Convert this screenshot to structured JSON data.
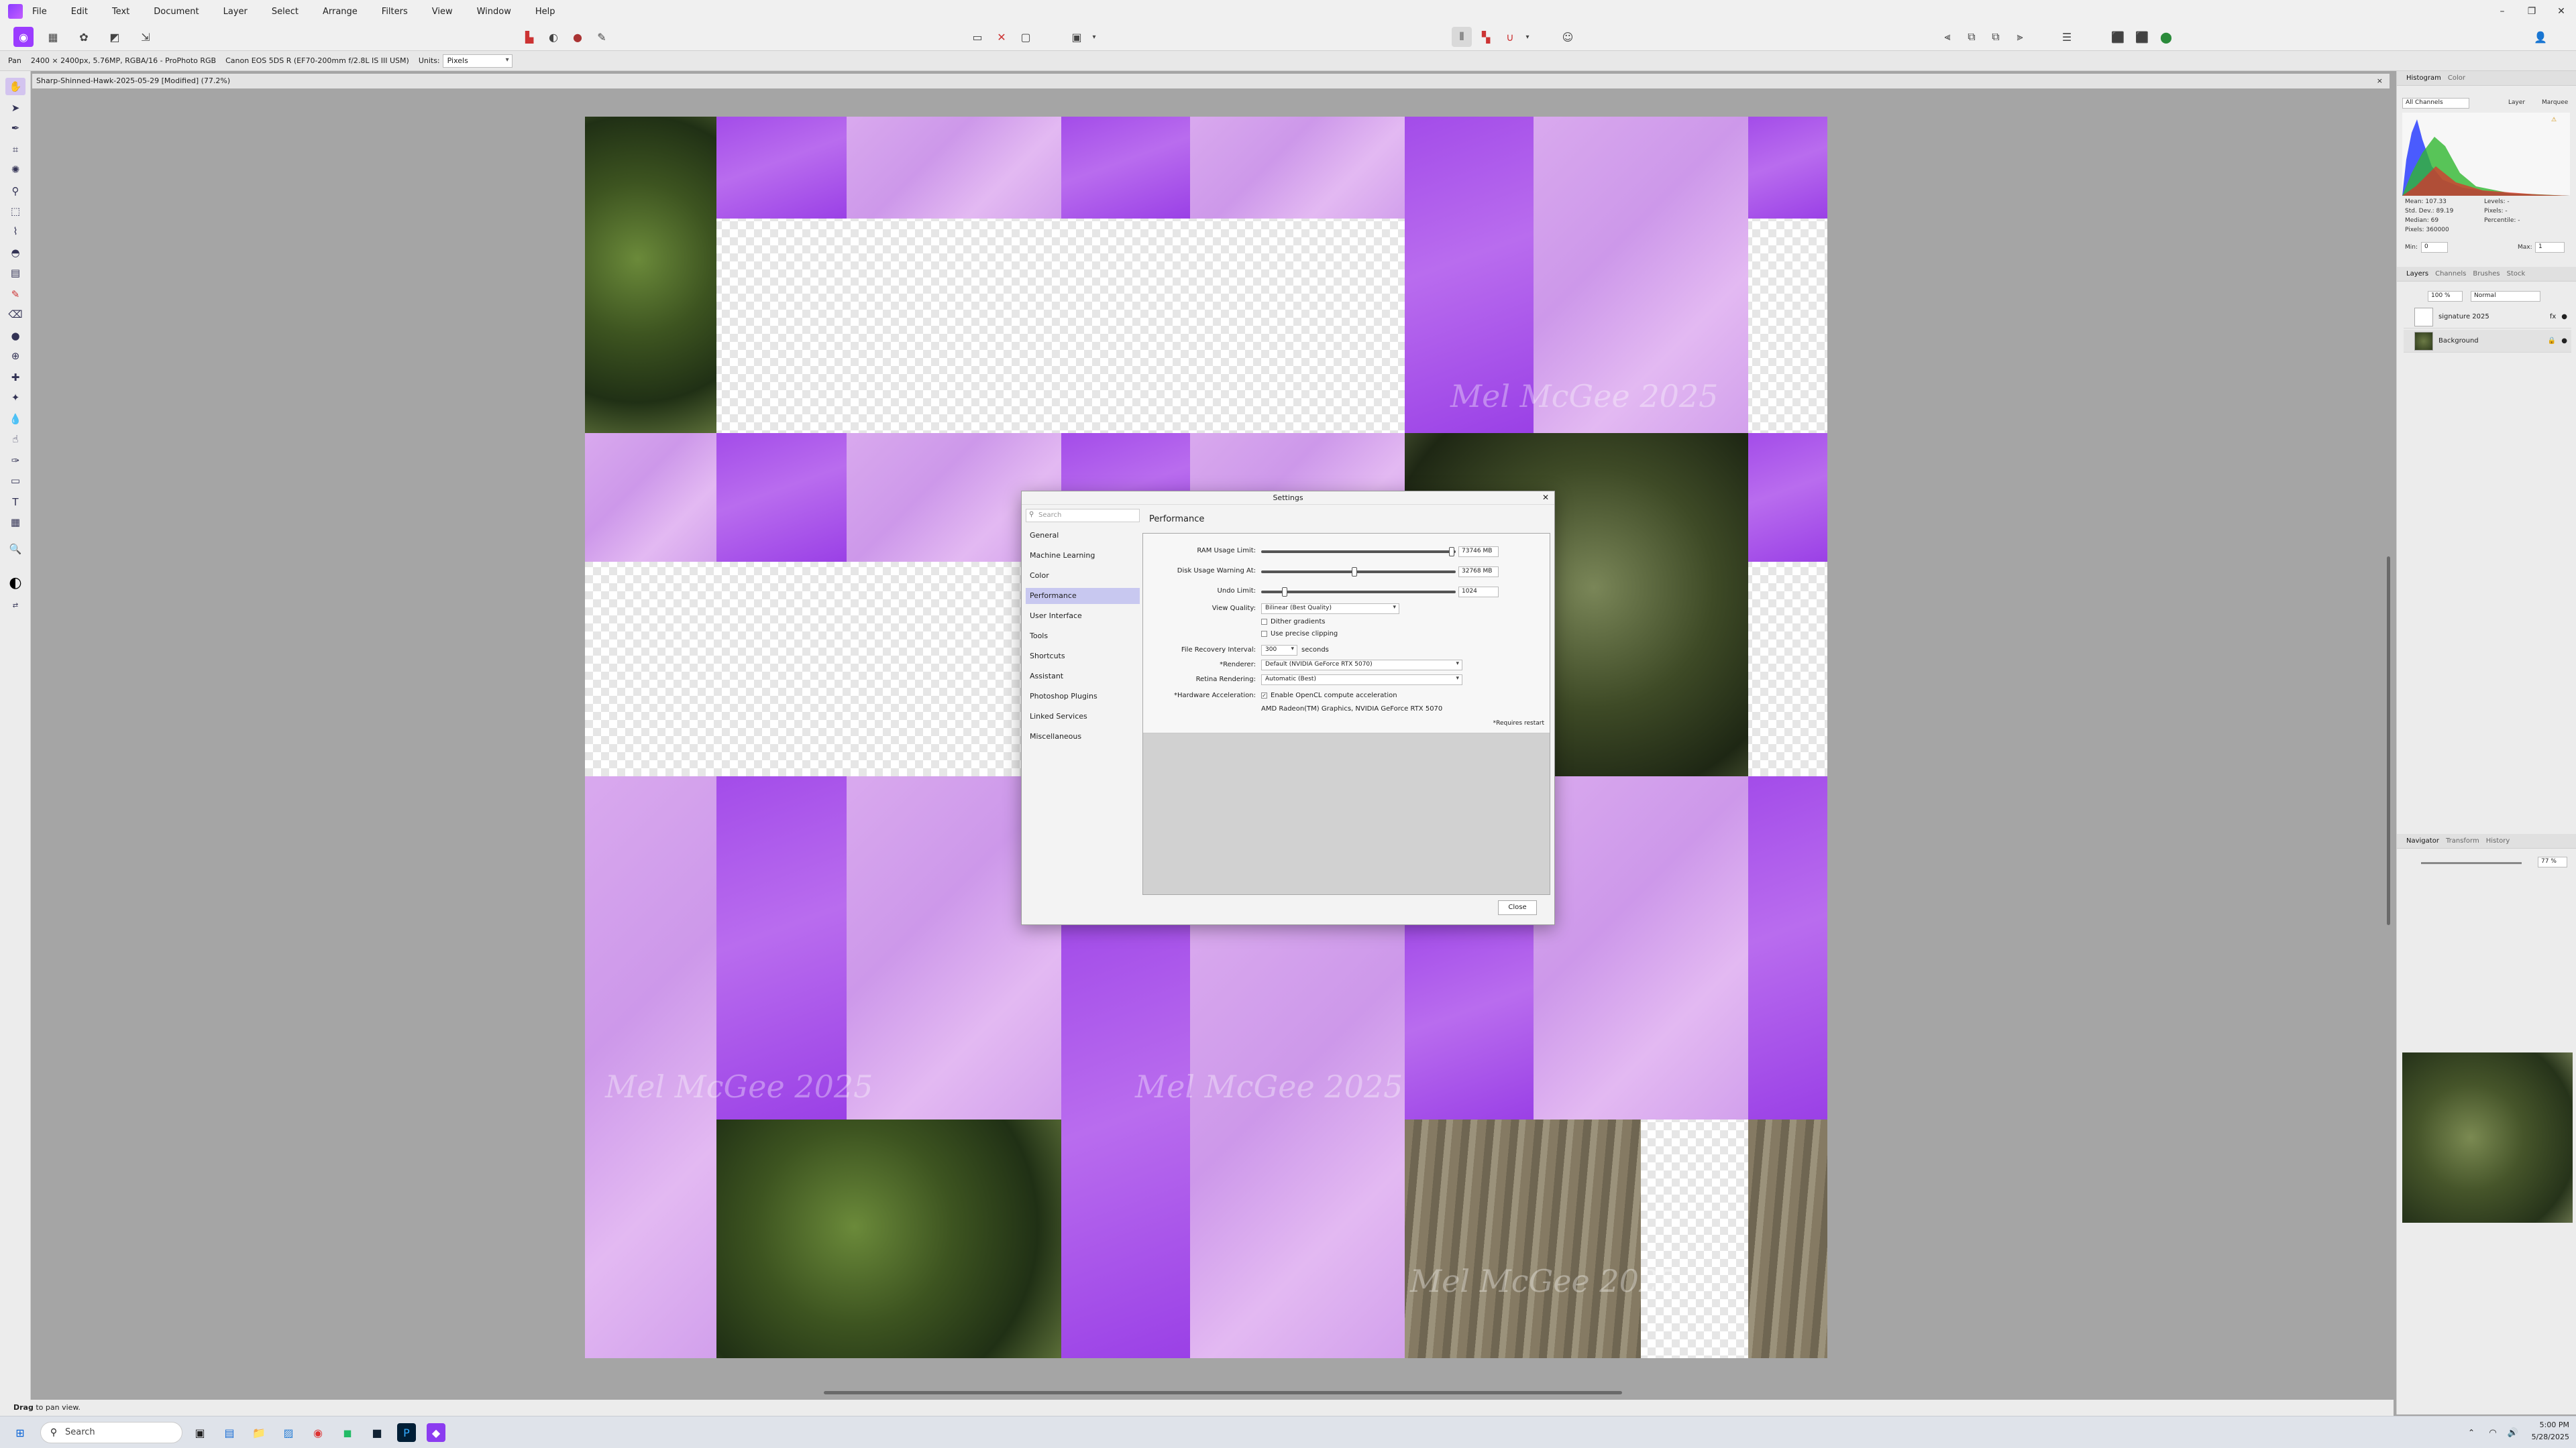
{
  "menubar": {
    "items": [
      "File",
      "Edit",
      "Text",
      "Document",
      "Layer",
      "Select",
      "Arrange",
      "Filters",
      "View",
      "Window",
      "Help"
    ]
  },
  "context": {
    "tool": "Pan",
    "doc_info": "2400 × 2400px, 5.76MP, RGBA/16 - ProPhoto RGB",
    "camera": "Canon EOS 5DS R (EF70-200mm f/2.8L IS III USM)",
    "units_label": "Units:",
    "units_value": "Pixels"
  },
  "document": {
    "tab_title": "Sharp-Shinned-Hawk-2025-05-29 [Modified] (77.2%)",
    "close": "×",
    "watermark": "Mel McGee 2025"
  },
  "status": {
    "hint_bold": "Drag",
    "hint_rest": "to pan view."
  },
  "histogram": {
    "tabs": [
      "Histogram",
      "Color"
    ],
    "channel": "All Channels",
    "layer_opt": "Layer",
    "marquee_opt": "Marquee",
    "stats": [
      "Mean: 107.33",
      "Std. Dev.: 89.19",
      "Median: 69",
      "Pixels: 360000"
    ],
    "stats_right": [
      "Levels: -",
      "Pixels: -",
      "Percentile: -"
    ],
    "min_label": "Min:",
    "min_value": "0",
    "max_label": "Max:",
    "max_value": "1"
  },
  "layers": {
    "tabs": [
      "Layers",
      "Channels",
      "Brushes",
      "Stock"
    ],
    "opacity": "100 %",
    "blend": "Normal",
    "items": [
      {
        "name": "signature 2025",
        "fx": "fx"
      },
      {
        "name": "Background",
        "fx": ""
      }
    ]
  },
  "navigator": {
    "tabs": [
      "Navigator",
      "Transform",
      "History"
    ],
    "zoom": "77 %"
  },
  "dialog": {
    "title": "Settings",
    "search_placeholder": "Search",
    "categories": [
      "General",
      "Machine Learning",
      "Color",
      "Performance",
      "User Interface",
      "Tools",
      "Shortcuts",
      "Assistant",
      "Photoshop Plugins",
      "Linked Services",
      "Miscellaneous"
    ],
    "selected_category": "Performance",
    "heading": "Performance",
    "ram_label": "RAM Usage Limit:",
    "ram_value": "73746 MB",
    "ram_fraction": 0.98,
    "disk_label": "Disk Usage Warning At:",
    "disk_value": "32768 MB",
    "disk_fraction": 0.48,
    "undo_label": "Undo Limit:",
    "undo_value": "1024",
    "undo_fraction": 0.12,
    "view_quality_label": "View Quality:",
    "view_quality_value": "Bilinear (Best Quality)",
    "dither_label": "Dither gradients",
    "precise_label": "Use precise clipping",
    "recovery_label": "File Recovery Interval:",
    "recovery_value": "300",
    "recovery_unit": "seconds",
    "renderer_label": "*Renderer:",
    "renderer_value": "Default (NVIDIA GeForce RTX 5070)",
    "retina_label": "Retina Rendering:",
    "retina_value": "Automatic (Best)",
    "hwaccel_label": "*Hardware Acceleration:",
    "hwaccel_option": "Enable OpenCL compute acceleration",
    "gpu_list": "AMD Radeon(TM) Graphics, NVIDIA GeForce RTX 5070",
    "restart_note": "*Requires restart",
    "close_label": "Close"
  },
  "taskbar": {
    "search_placeholder": "Search",
    "time": "5:00 PM",
    "date": "5/28/2025"
  }
}
